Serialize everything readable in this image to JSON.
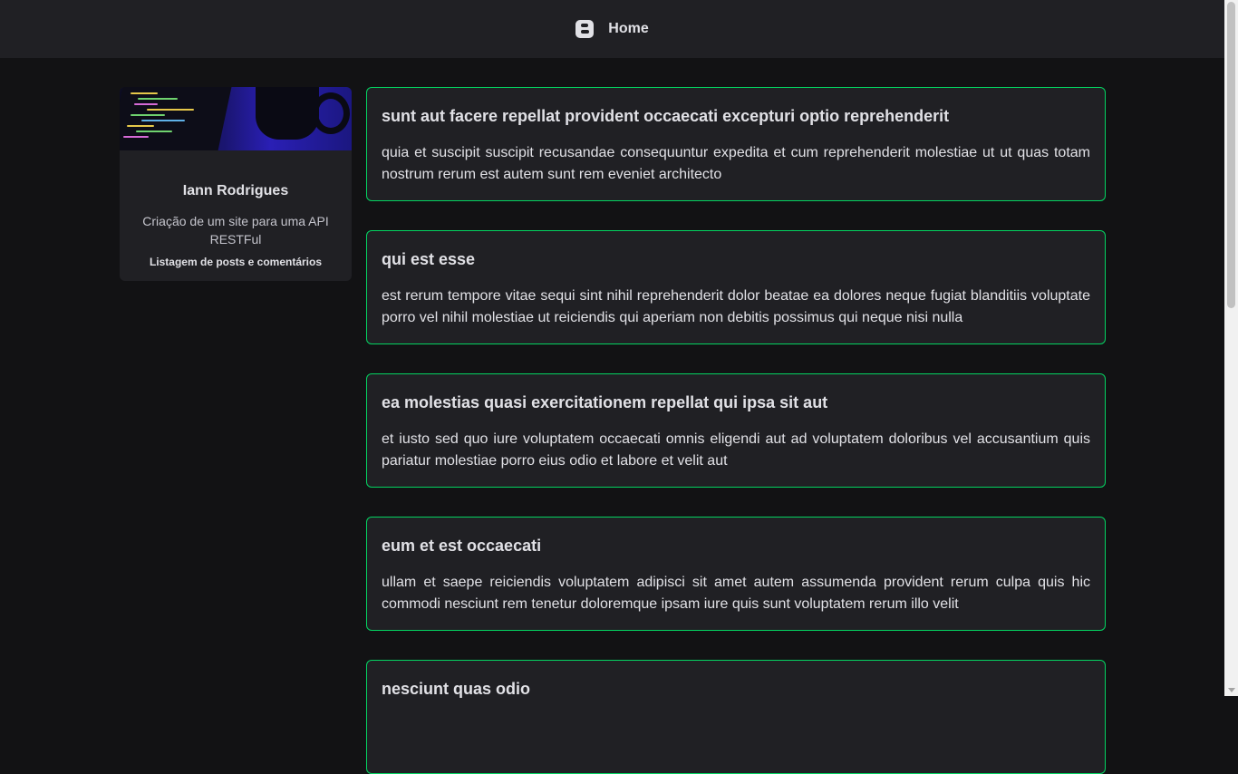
{
  "header": {
    "title": "Home",
    "icon": "blogger-icon"
  },
  "profile": {
    "name": "Iann Rodrigues",
    "description": "Criação de um site para uma API RESTFul",
    "subtitle": "Listagem de posts e comentários"
  },
  "posts": [
    {
      "title": "sunt aut facere repellat provident occaecati excepturi optio reprehenderit",
      "body": "quia et suscipit suscipit recusandae consequuntur expedita et cum reprehenderit molestiae ut ut quas totam nostrum rerum est autem sunt rem eveniet architecto"
    },
    {
      "title": "qui est esse",
      "body": "est rerum tempore vitae sequi sint nihil reprehenderit dolor beatae ea dolores neque fugiat blanditiis voluptate porro vel nihil molestiae ut reiciendis qui aperiam non debitis possimus qui neque nisi nulla"
    },
    {
      "title": "ea molestias quasi exercitationem repellat qui ipsa sit aut",
      "body": "et iusto sed quo iure voluptatem occaecati omnis eligendi aut ad voluptatem doloribus vel accusantium quis pariatur molestiae porro eius odio et labore et velit aut"
    },
    {
      "title": "eum et est occaecati",
      "body": "ullam et saepe reiciendis voluptatem adipisci sit amet autem assumenda provident rerum culpa quis hic commodi nesciunt rem tenetur doloremque ipsam iure quis sunt voluptatem rerum illo velit"
    },
    {
      "title": "nesciunt quas odio",
      "body": ""
    }
  ],
  "colors": {
    "background": "#121214",
    "surface": "#202024",
    "accent_border": "#04d361",
    "text": "#e1e1e6"
  }
}
